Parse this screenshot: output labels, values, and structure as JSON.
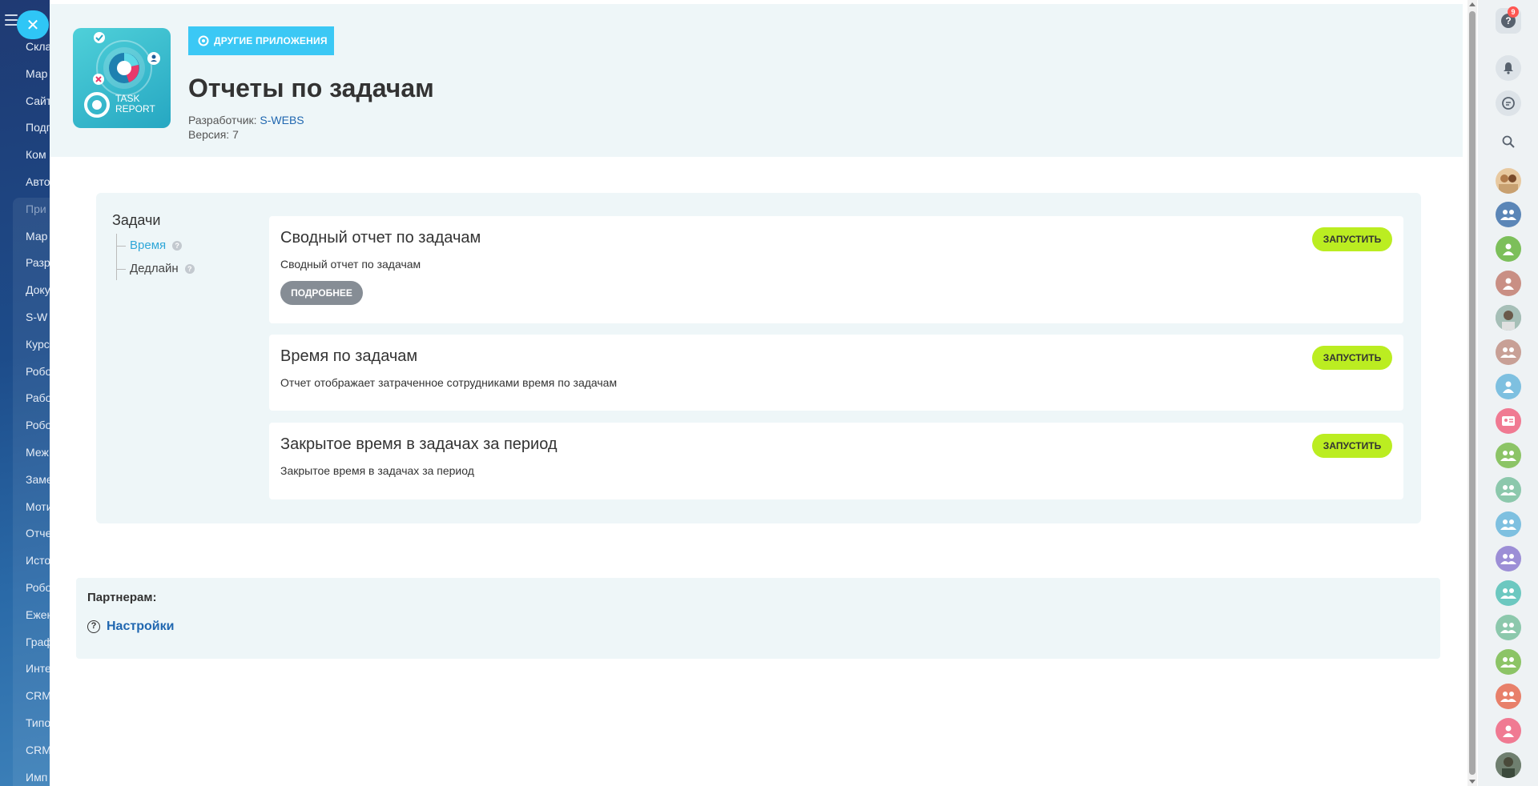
{
  "sidebar": {
    "items": [
      "Скла",
      "Мар",
      "Сайт",
      "Подг",
      "Ком",
      "Авто",
      "При",
      "Мар",
      "Разр",
      "Доку",
      "S-W",
      "Курс",
      "Робо",
      "Рабо",
      "Робо",
      "Меж",
      "Заме",
      "Моти",
      "Отче",
      "Исто",
      "Робо",
      "Ежен",
      "Граф",
      "Инте",
      "CRM",
      "Типо",
      "CRM",
      "Имп"
    ]
  },
  "app": {
    "other_apps_label": "ДРУГИЕ ПРИЛОЖЕНИЯ",
    "title": "Отчеты по задачам",
    "developer_label": "Разработчик:",
    "developer_name": "S-WEBS",
    "version_label": "Версия: 7",
    "icon_text_1": "TASK",
    "icon_text_2": "REPORT"
  },
  "nav": {
    "title": "Задачи",
    "items": [
      {
        "label": "Время",
        "active": true
      },
      {
        "label": "Дедлайн",
        "active": false
      }
    ]
  },
  "reports": [
    {
      "title": "Сводный отчет по задачам",
      "description": "Сводный отчет по задачам",
      "run_label": "ЗАПУСТИТЬ",
      "more_label": "ПОДРОБНЕЕ"
    },
    {
      "title": "Время по задачам",
      "description": "Отчет отображает затраченное сотрудниками время по задачам",
      "run_label": "ЗАПУСТИТЬ"
    },
    {
      "title": "Закрытое время в задачах за период",
      "description": "Закрытое время в задачах за период",
      "run_label": "ЗАПУСТИТЬ"
    }
  ],
  "partners": {
    "title": "Партнерам:",
    "settings_label": "Настройки"
  },
  "right_bar": {
    "help_badge": "9"
  },
  "colors": {
    "run_button": "#bbed21",
    "accent_blue": "#3bc8f5",
    "link": "#2067b0",
    "panel_bg": "#eef6f8",
    "badge_red": "#ff5752"
  }
}
